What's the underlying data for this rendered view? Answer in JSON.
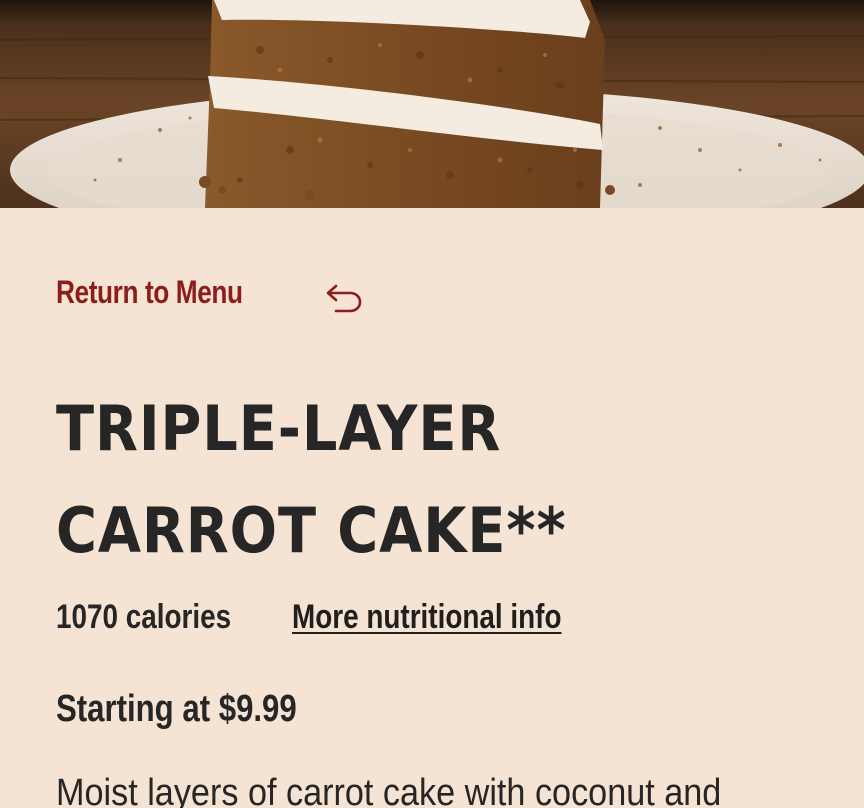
{
  "hero": {
    "image_alt": "Slice of triple-layer carrot cake on a plate"
  },
  "nav": {
    "return_label": "Return to Menu",
    "return_icon": "return-arrow-icon"
  },
  "product": {
    "title_line1": "Triple-Layer",
    "title_line2": "Carrot Cake**",
    "calories": "1070 calories",
    "nutrition_link": "More nutritional info",
    "price": "Starting at $9.99",
    "description": "Moist layers of carrot cake with coconut and"
  },
  "colors": {
    "background": "#f5e4d3",
    "accent": "#8c1d1d",
    "text": "#262626"
  }
}
